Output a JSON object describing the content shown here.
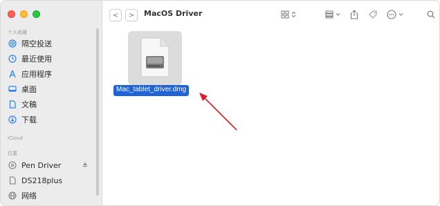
{
  "window": {
    "title": "MacOS Driver"
  },
  "sidebar": {
    "favorites_label": "个人收藏",
    "favorites": [
      {
        "label": "隔空投送",
        "icon": "airdrop-icon"
      },
      {
        "label": "最近使用",
        "icon": "clock-icon"
      },
      {
        "label": "应用程序",
        "icon": "applications-icon"
      },
      {
        "label": "桌面",
        "icon": "desktop-icon"
      },
      {
        "label": "文稿",
        "icon": "document-icon"
      },
      {
        "label": "下载",
        "icon": "download-icon"
      }
    ],
    "icloud_label": "iCloud",
    "locations_label": "位置",
    "locations": [
      {
        "label": "Pen Driver",
        "icon": "disk-icon"
      },
      {
        "label": "DS218plus",
        "icon": "display-icon"
      },
      {
        "label": "网络",
        "icon": "network-icon"
      }
    ]
  },
  "toolbar": {
    "back": "<",
    "forward": ">",
    "view": "88",
    "view_chevron": "⌃",
    "group": "▦",
    "group_chevron": "⌄",
    "share": "⍐",
    "tag": "◇",
    "more": "⊙",
    "more_chevron": "⌄",
    "search": "Q"
  },
  "files": [
    {
      "name": "Mac_tablet_driver.dmg",
      "selected": true
    }
  ],
  "colors": {
    "accent": "#1f63d6",
    "arrow": "#d81e28",
    "sidebar_bg": "#ececec"
  }
}
